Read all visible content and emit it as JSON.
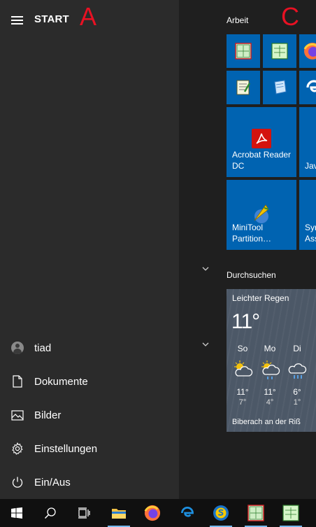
{
  "start": {
    "title": "START",
    "annotation_a": "A",
    "annotation_c": "C"
  },
  "left_menu": {
    "user": "tiad",
    "items": [
      {
        "label": "Dokumente",
        "icon": "document-icon"
      },
      {
        "label": "Bilder",
        "icon": "pictures-icon"
      },
      {
        "label": "Einstellungen",
        "icon": "gear-icon"
      },
      {
        "label": "Ein/Aus",
        "icon": "power-icon"
      }
    ]
  },
  "groups": {
    "arbeit": "Arbeit",
    "durchsuchen": "Durchsuchen"
  },
  "tiles": {
    "acrobat": "Acrobat Reader\nDC",
    "acrobat_icon_letter": "A",
    "java_partial": "Jav",
    "minitool": "MiniTool\nPartition…",
    "sym_partial": "Syr\nAss"
  },
  "weather": {
    "condition": "Leichter Regen",
    "temperature": "11°",
    "days": [
      {
        "day": "So",
        "high": "11°",
        "low": "7°"
      },
      {
        "day": "Mo",
        "high": "11°",
        "low": "4°"
      },
      {
        "day": "Di",
        "high": "6°",
        "low": "1°"
      }
    ],
    "location": "Biberach an der Riß"
  },
  "colors": {
    "tile_blue": "#0063b1",
    "weather_bg": "#4c5867",
    "annotation_red": "#e81123"
  }
}
